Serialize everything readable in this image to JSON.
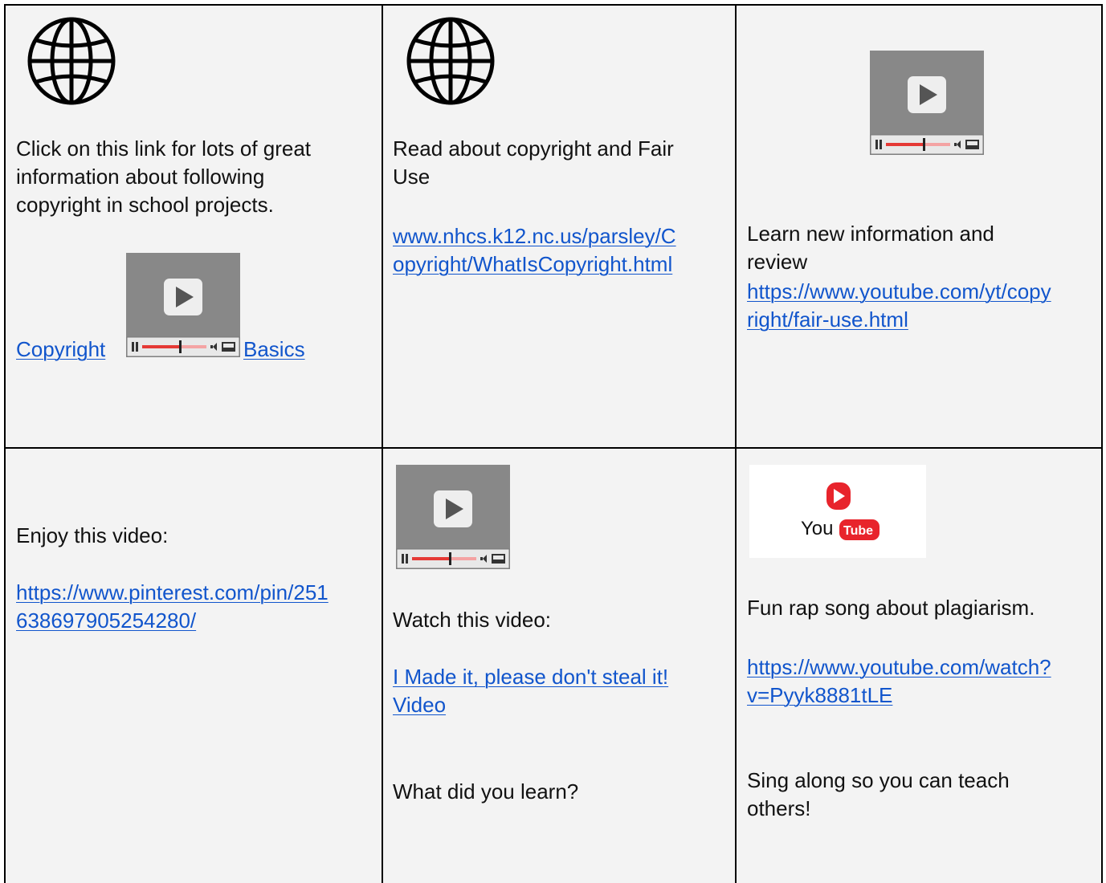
{
  "cells": {
    "c1": {
      "text_lines": [
        "Click on this link for lots of great",
        "information about following",
        "copyright in school projects."
      ],
      "link_part1": "Copyright ",
      "link_part2": "Basics"
    },
    "c2": {
      "text_lines": [
        "Read about copyright and Fair",
        "Use"
      ],
      "link_lines": [
        "www.nhcs.k12.nc.us/parsley/C",
        "opyright/WhatIsCopyright.html"
      ]
    },
    "c3": {
      "text_lines": [
        "Learn new information  and",
        "review"
      ],
      "link_lines": [
        "https://www.youtube.com/yt/copy",
        "right/fair-use.html"
      ]
    },
    "c4": {
      "text": "Enjoy this video:",
      "link_lines": [
        "https://www.pinterest.com/pin/251",
        "638697905254280/"
      ]
    },
    "c5": {
      "text": "Watch this video:",
      "link_lines": [
        "I Made it, please don't steal it!",
        "Video"
      ],
      "question": "What did you learn?"
    },
    "c6": {
      "logo_text_you": "You",
      "logo_text_tube": "Tube",
      "text": "Fun rap song about plagiarism.",
      "link_lines": [
        "https://www.youtube.com/watch?",
        "v=Pyyk8881tLE"
      ],
      "closing_lines": [
        "Sing along so you can teach",
        "others!"
      ]
    }
  },
  "icons": {
    "globe": "globe-icon",
    "video": "video-player-icon",
    "youtube": "youtube-logo"
  }
}
